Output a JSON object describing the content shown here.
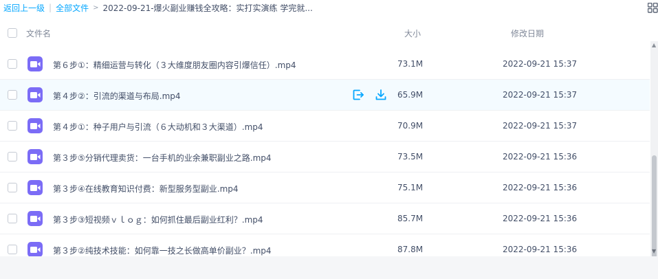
{
  "breadcrumb": {
    "back": "返回上一级",
    "root": "全部文件",
    "current": "2022-09-21-爆火副业赚钱全攻略：实打实演练 学完就..."
  },
  "header": {
    "col_name": "文件名",
    "col_size": "大小",
    "col_date": "修改日期"
  },
  "colors": {
    "link": "#06a7ff",
    "video_icon": "#7b6cf6",
    "row_hover": "#f4fbff"
  },
  "icons": {
    "file": "video-file-icon",
    "share": "share-icon",
    "download": "download-icon",
    "view_toggle": "grid-view-icon"
  },
  "files": [
    {
      "name": "第６步①：精细运营与转化（３大维度朋友圈内容引爆信任）.mp4",
      "size": "73.1M",
      "date": "2022-09-21 15:37"
    },
    {
      "name": "第４步②：引流的渠道与布局.mp4",
      "size": "65.9M",
      "date": "2022-09-21 15:37"
    },
    {
      "name": "第４步①：种子用户与引流（６大动机和３大渠道）.mp4",
      "size": "70.9M",
      "date": "2022-09-21 15:37"
    },
    {
      "name": "第３步⑤分销代理卖货：一台手机的业余兼职副业之路.mp4",
      "size": "73.5M",
      "date": "2022-09-21 15:36"
    },
    {
      "name": "第３步④在线教育知识付费：新型服务型副业.mp4",
      "size": "75.1M",
      "date": "2022-09-21 15:36"
    },
    {
      "name": "第３步③短视频ｖｌｏｇ：如何抓住最后副业红利？.mp4",
      "size": "85.7M",
      "date": "2022-09-21 15:36"
    },
    {
      "name": "第３步②纯技术技能：如何靠一技之长做高单价副业？.mp4",
      "size": "87.8M",
      "date": "2022-09-21 15:36"
    }
  ]
}
